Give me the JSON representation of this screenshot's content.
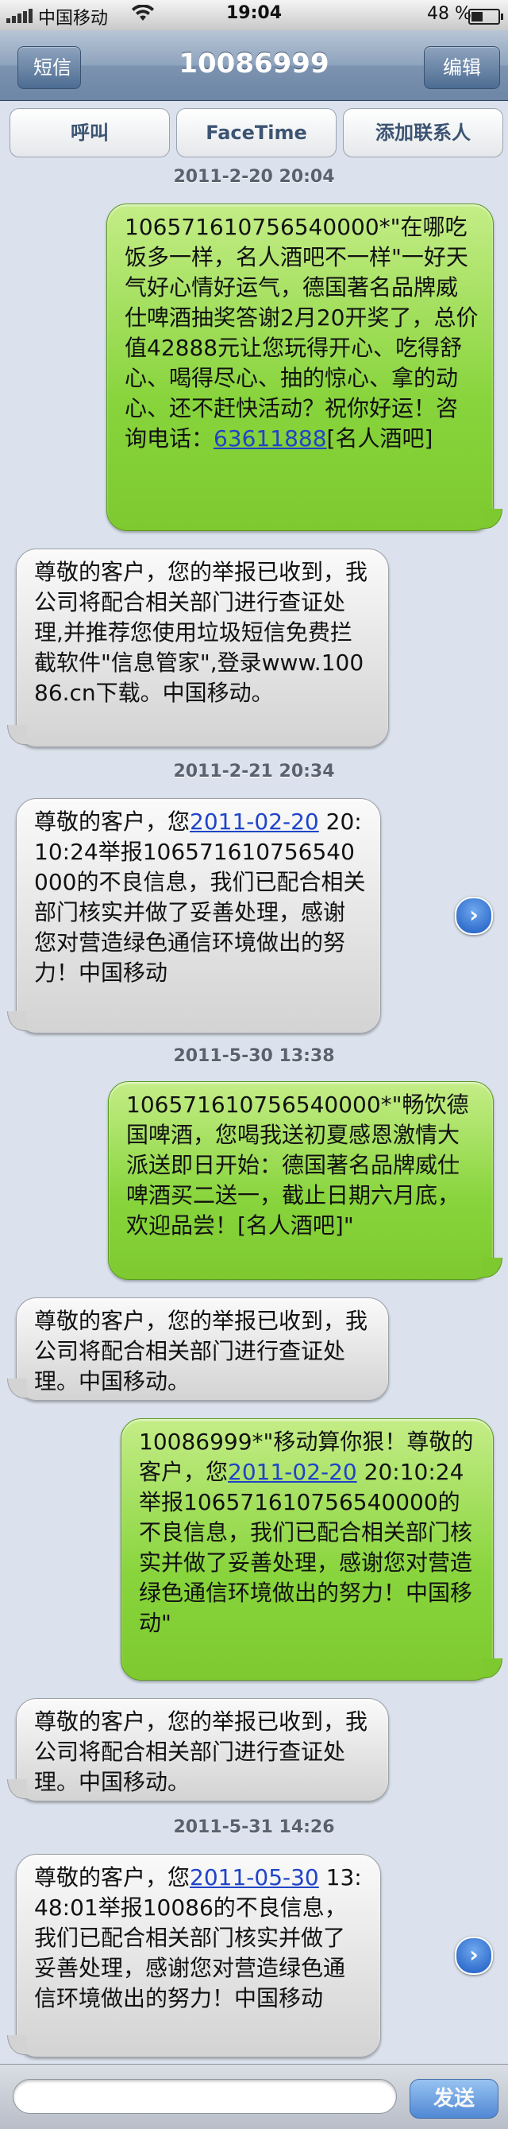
{
  "status_bar": {
    "carrier": "中国移动",
    "time": "19:04",
    "battery": "48 %",
    "battery_level": 0.48
  },
  "nav": {
    "back_label": "短信",
    "title": "10086999",
    "edit_label": "编辑"
  },
  "actions": {
    "call": "呼叫",
    "facetime": "FaceTime",
    "add_contact": "添加联系人"
  },
  "thread": {
    "ts1": "2011-2-20 20:04",
    "m1_text": "10657161075654000​0*\"在哪吃饭多一样，名人酒吧不一样\"一好天气好心情好运气，德国著名品牌威仕啤酒抽奖答谢2月20开奖了，总价值42888元让您玩得开心、吃得舒心、喝得尽心、抽的惊心、拿的动心、还不赶快活动？祝你好运！咨询电话：",
    "m1_link": "63611888",
    "m1_tail": "[名人酒吧]",
    "m2_text": "尊敬的客户，您的举报已收到，我公司将配合相关部门进行查证处理,并推荐您使用垃圾短信免费拦截软件\"信息管家\",登录www.10086.cn下载。中国移动。",
    "ts2": "2011-2-21 20:34",
    "m3_head": "尊敬的客户，您",
    "m3_link": "2011-02-20",
    "m3_tail": " 20:10:24举报106571610756540000的不良信息，我们已配合相关部门核实并做了妥善处理，感谢您对营造绿色通信环境做出的努力！中国移动",
    "ts3": "2011-5-30 13:38",
    "m4_text": "106571610756540000*\"畅饮德国啤酒，您喝我送初夏感恩激情大派送即日开始：德国著名品牌威仕啤酒买二送一，截止日期六月底，欢迎品尝！[名人酒吧]\"",
    "m5_text": "尊敬的客户，您的举报已收到，我公司将配合相关部门进行查证处理。中国移动。",
    "m6_head": "10086999*\"移动算你狠！尊敬的客户，您",
    "m6_link": "2011-02-20",
    "m6_tail": " 20:10:24举报106571610756540000的不良信息，我们已配合相关部门核实并做了妥善处理，感谢您对营造绿色通信环境做出的努力！中国移动\"",
    "m7_text": "尊敬的客户，您的举报已收到，我公司将配合相关部门进行查证处理。中国移动。",
    "ts4": "2011-5-31 14:26",
    "m8_head": "尊敬的客户，您",
    "m8_link": "2011-05-30",
    "m8_tail": " 13:48:01举报10086的不良信息，我们已配合相关部门核实并做了妥善处理，感谢您对营造绿色通信环境做出的努力！中国移动"
  },
  "composer": {
    "send_label": "发送"
  },
  "icons": {
    "wifi": "wifi-icon",
    "chevron": "chevron-right-icon"
  }
}
